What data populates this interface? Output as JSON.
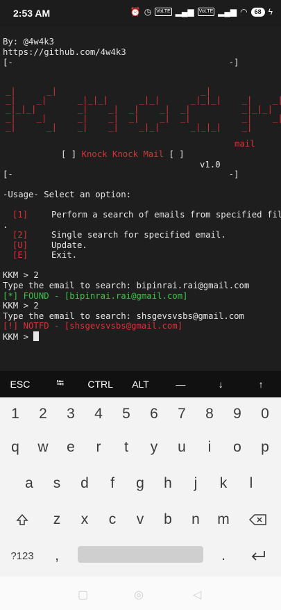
{
  "status_bar": {
    "time": "2:53 AM",
    "battery": "68",
    "net1": "VoLTE",
    "net2": "VoLTE"
  },
  "terminal": {
    "line_by": "By: @4w4k3",
    "line_url": "https://github.com/4w4k3",
    "bracket_top": "[-                                          -]",
    "ascii_art": "_|      _|                            _|\n_|    _|      _|_|_|      _|_|      _|_|_|    _|    _|\n_|_|_|        _|    _|  _|    _|  _|          _|_|_|\n_|    _|      _|    _|  _|    _|  _|          _|    _|\n_|      _|    _|    _|    _|_|      _|_|_|    _|      _|",
    "ascii_mail": "mail",
    "title_open": "[ ] ",
    "title_text": "Knock Knock Mail",
    "title_close": " [ ]",
    "version": "v1.0",
    "bracket_bottom": "[-                                          -]",
    "usage": "-Usage- Select an option:",
    "menu": [
      {
        "key": "[1]",
        "text": "Perform a search of emails from specified file"
      },
      {
        "key": "[2]",
        "text": "Single search for specified email."
      },
      {
        "key": "[U]",
        "text": "Update."
      },
      {
        "key": "[E]",
        "text": "Exit."
      }
    ],
    "wrap_dot": ".",
    "session": [
      {
        "text": "KKM > 2",
        "color": "default"
      },
      {
        "text": "Type the email to search: bipinrai.rai@gmail.com",
        "color": "default"
      },
      {
        "text": "[*] FOUND - [bipinrai.rai@gmail.com]",
        "color": "green"
      },
      {
        "text": "KKM > 2",
        "color": "default"
      },
      {
        "text": "Type the email to search: shsgevsvsbs@gmail.com",
        "color": "default"
      },
      {
        "text": "[!] NOTFD - [shsgevsvsbs@gmail.com]",
        "color": "red"
      }
    ],
    "prompt": "KKM > "
  },
  "extra_keys": [
    "ESC",
    "⭾",
    "CTRL",
    "ALT",
    "—",
    "↓",
    "↑"
  ],
  "keyboard": {
    "row_numbers": [
      "1",
      "2",
      "3",
      "4",
      "5",
      "6",
      "7",
      "8",
      "9",
      "0"
    ],
    "row_top": [
      "q",
      "w",
      "e",
      "r",
      "t",
      "y",
      "u",
      "i",
      "o",
      "p"
    ],
    "row_home": [
      "a",
      "s",
      "d",
      "f",
      "g",
      "h",
      "j",
      "k",
      "l"
    ],
    "row_bottom": [
      "z",
      "x",
      "c",
      "v",
      "b",
      "n",
      "m"
    ],
    "symbols_label": "?123",
    "comma": ",",
    "period": "."
  }
}
